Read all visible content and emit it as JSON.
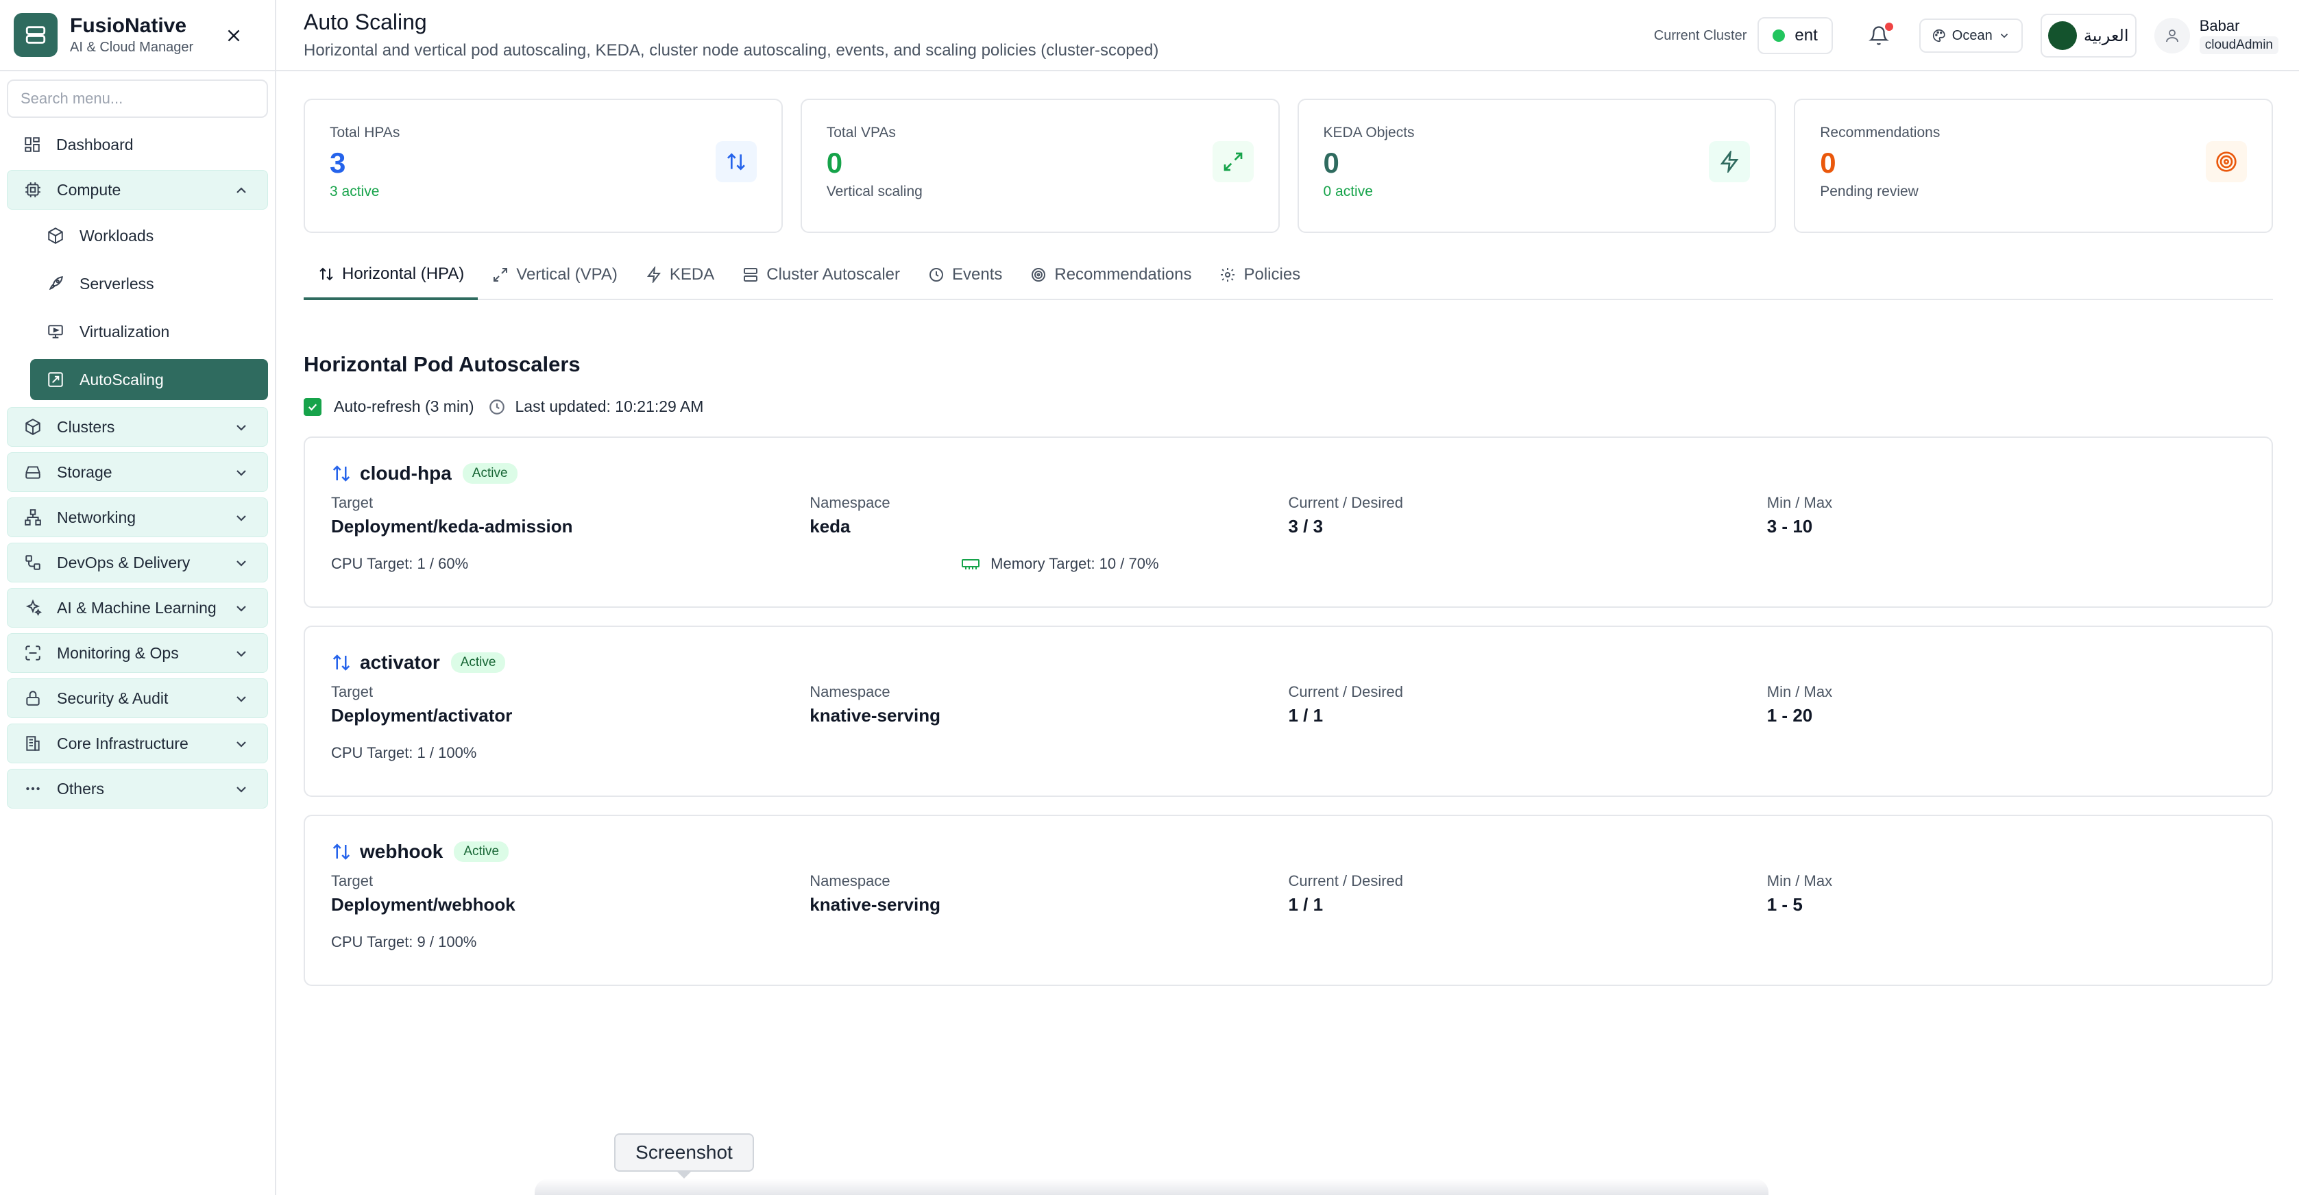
{
  "brand": {
    "name": "FusioNative",
    "subtitle": "AI & Cloud Manager"
  },
  "sidebar": {
    "search_placeholder": "Search menu...",
    "dashboard": "Dashboard",
    "compute": {
      "label": "Compute",
      "items": [
        "Workloads",
        "Serverless",
        "Virtualization",
        "AutoScaling"
      ]
    },
    "groups": [
      "Clusters",
      "Storage",
      "Networking",
      "DevOps & Delivery",
      "AI & Machine Learning",
      "Monitoring & Ops",
      "Security & Audit",
      "Core Infrastructure",
      "Others"
    ]
  },
  "header": {
    "title": "Auto Scaling",
    "subtitle": "Horizontal and vertical pod autoscaling, KEDA, cluster node autoscaling, events, and scaling policies (cluster-scoped)",
    "cluster_label": "Current Cluster",
    "cluster_name": "ent",
    "theme": "Ocean",
    "language": "العربية",
    "user_name": "Babar",
    "user_role": "cloudAdmin"
  },
  "stats": [
    {
      "label": "Total HPAs",
      "value": "3",
      "sub": "3 active",
      "color": "#2563eb",
      "sub_color": "#16a34a",
      "icon": "arrows-up-down-icon",
      "icon_bg": "#eff6ff"
    },
    {
      "label": "Total VPAs",
      "value": "0",
      "sub": "Vertical scaling",
      "color": "#16a34a",
      "sub_color": "#4b5563",
      "icon": "expand-icon",
      "icon_bg": "#f0fdf4"
    },
    {
      "label": "KEDA Objects",
      "value": "0",
      "sub": "0 active",
      "color": "#2f6b5f",
      "sub_color": "#16a34a",
      "icon": "lightning-icon",
      "icon_bg": "#ecfdf5"
    },
    {
      "label": "Recommendations",
      "value": "0",
      "sub": "Pending review",
      "color": "#ea580c",
      "sub_color": "#4b5563",
      "icon": "target-icon",
      "icon_bg": "#fff7ed"
    }
  ],
  "tabs": [
    "Horizontal (HPA)",
    "Vertical (VPA)",
    "KEDA",
    "Cluster Autoscaler",
    "Events",
    "Recommendations",
    "Policies"
  ],
  "section": {
    "title": "Horizontal Pod Autoscalers",
    "auto_refresh": "Auto-refresh (3 min)",
    "last_updated": "Last updated: 10:21:29 AM"
  },
  "hpa_labels": {
    "target": "Target",
    "namespace": "Namespace",
    "current": "Current / Desired",
    "minmax": "Min / Max"
  },
  "hpas": [
    {
      "name": "cloud-hpa",
      "status": "Active",
      "target": "Deployment/keda-admission",
      "namespace": "keda",
      "current": "3 / 3",
      "minmax": "3 - 10",
      "cpu": "CPU Target: 1 / 60%",
      "memory": "Memory Target: 10 / 70%"
    },
    {
      "name": "activator",
      "status": "Active",
      "target": "Deployment/activator",
      "namespace": "knative-serving",
      "current": "1 / 1",
      "minmax": "1 - 20",
      "cpu": "CPU Target: 1 / 100%"
    },
    {
      "name": "webhook",
      "status": "Active",
      "target": "Deployment/webhook",
      "namespace": "knative-serving",
      "current": "1 / 1",
      "minmax": "1 - 5",
      "cpu": "CPU Target: 9 / 100%"
    }
  ],
  "tooltip": "Screenshot"
}
